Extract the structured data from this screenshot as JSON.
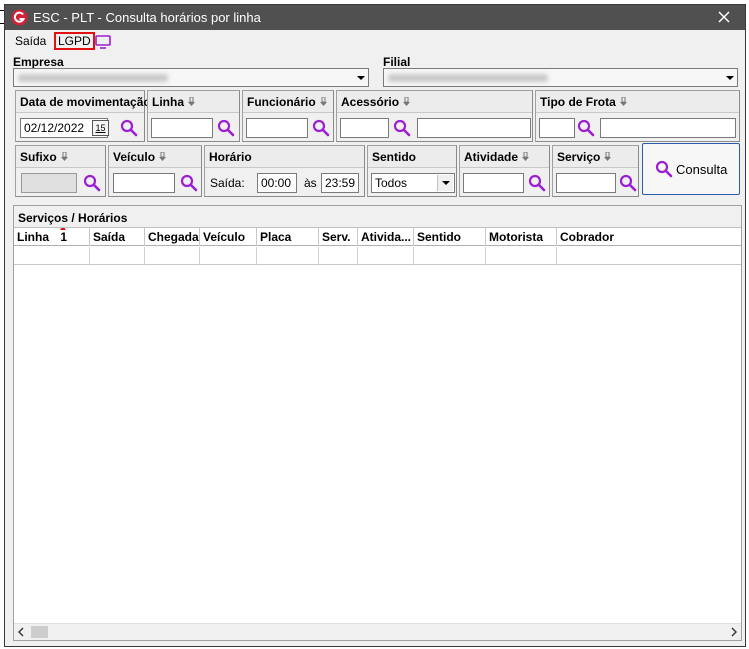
{
  "window": {
    "title": "ESC - PLT - Consulta horários por linha"
  },
  "menu": {
    "saida": "Saída",
    "lgpd": "LGPD",
    "monitor_icon": "monitor-icon"
  },
  "empresa": {
    "label": "Empresa"
  },
  "filial": {
    "label": "Filial"
  },
  "filters": {
    "data_mov": {
      "title": "Data de movimentação",
      "value": "02/12/2022",
      "cal": "15"
    },
    "linha": {
      "title": "Linha"
    },
    "funcionario": {
      "title": "Funcionário"
    },
    "acessorio": {
      "title": "Acessório"
    },
    "tipo_frota": {
      "title": "Tipo de Frota"
    },
    "sufixo": {
      "title": "Sufixo"
    },
    "veiculo": {
      "title": "Veículo"
    },
    "horario": {
      "title": "Horário",
      "saida_label": "Saída:",
      "saida_value": "00:00",
      "as_label": "às",
      "ate_value": "23:59"
    },
    "sentido": {
      "title": "Sentido",
      "value": "Todos"
    },
    "atividade": {
      "title": "Atividade"
    },
    "servico": {
      "title": "Serviço"
    }
  },
  "consulta_button": {
    "label": "Consulta"
  },
  "grid": {
    "caption": "Serviços / Horários",
    "sort_indicator": "1",
    "columns": [
      "Linha",
      "Saída",
      "Chegada",
      "Veículo",
      "Placa",
      "Serv.",
      "Ativida...",
      "Sentido",
      "Motorista",
      "Cobrador"
    ]
  },
  "colors": {
    "accent": "#9b1fd1",
    "titlebar": "#505050",
    "highlight_border": "#e01010",
    "logo": "#d0233a"
  }
}
